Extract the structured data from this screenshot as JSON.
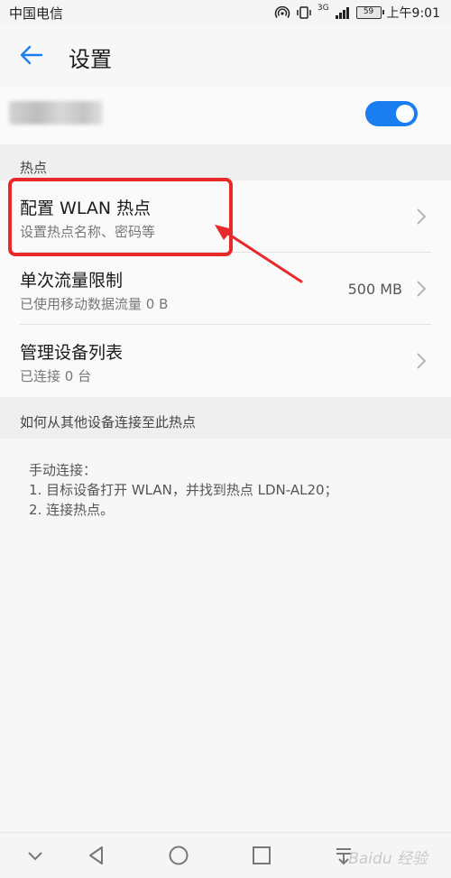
{
  "status_bar": {
    "carrier": "中国电信",
    "network": "3G",
    "battery": "59",
    "time": "上午9:01"
  },
  "header": {
    "title": "设置"
  },
  "hotspot_toggle": {
    "on": true
  },
  "section_hotspot": {
    "label": "热点"
  },
  "rows": [
    {
      "title": "配置 WLAN 热点",
      "subtitle": "设置热点名称、密码等",
      "value": ""
    },
    {
      "title": "单次流量限制",
      "subtitle": "已使用移动数据流量 0 B",
      "value": "500 MB"
    },
    {
      "title": "管理设备列表",
      "subtitle": "已连接 0 台",
      "value": ""
    }
  ],
  "section_connect": {
    "label": "如何从其他设备连接至此热点"
  },
  "instructions": {
    "heading": "手动连接：",
    "step1": "1. 目标设备打开 WLAN，并找到热点 LDN-AL20；",
    "step2": "2. 连接热点。"
  },
  "watermark": "Baidu 经验",
  "colors": {
    "accent": "#1a7ef0",
    "annotation": "#e8292a"
  }
}
